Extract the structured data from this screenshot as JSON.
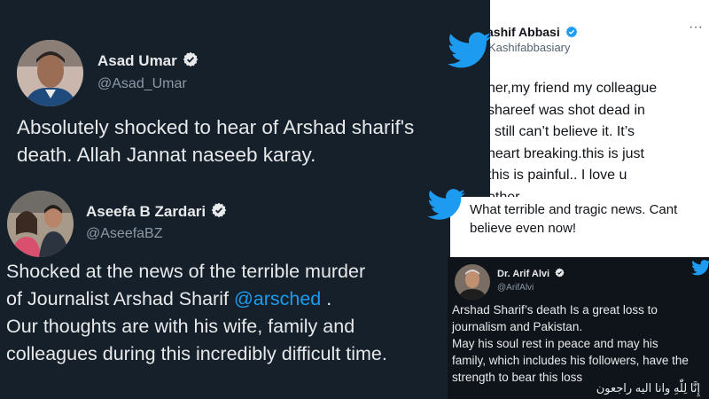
{
  "tweets": {
    "asad": {
      "name": "Asad Umar",
      "handle": "@Asad_Umar",
      "lines": [
        "Absolutely shocked to hear of Arshad sharif's",
        "death. Allah Jannat naseeb karay."
      ]
    },
    "aseefa": {
      "name": "Aseefa B Zardari",
      "handle": "@AseefaBZ",
      "line1": "Shocked at the news of the terrible murder",
      "line2_prefix": "of Journalist Arshad Sharif ",
      "line2_mention": "@arsched",
      "line2_suffix": " .",
      "line3": "Our thoughts are with his wife, family and",
      "line4": "colleagues during this incredibly difficult time."
    },
    "kashif": {
      "name": "ashif Abbasi",
      "handle": "Kashifabbasiary",
      "menu": "···",
      "lines": [
        "her,my friend my colleague",
        "shareef was shot dead in",
        "l still can’t believe it. It’s",
        "heart breaking.this is just",
        "this is painful.. I love u",
        "other"
      ]
    },
    "middle": {
      "lines": [
        "What terrible and tragic news. Cant",
        "believe even now!"
      ]
    },
    "alvi": {
      "name": "Dr. Arif Alvi",
      "handle": "@ArifAlvi",
      "lines": [
        "Arshad Sharif’s death Is a great loss to",
        "journalism and Pakistan.",
        "May his soul rest in peace and may his",
        "family, which includes his followers, have the",
        "strength to bear this loss"
      ],
      "arabic": "إِنَّا لِلّٰهِ وانا اليه راجعون"
    }
  },
  "colors": {
    "twitter_blue": "#1d9bf0",
    "dark_bg": "#15202b",
    "light_bg": "#ffffff"
  }
}
